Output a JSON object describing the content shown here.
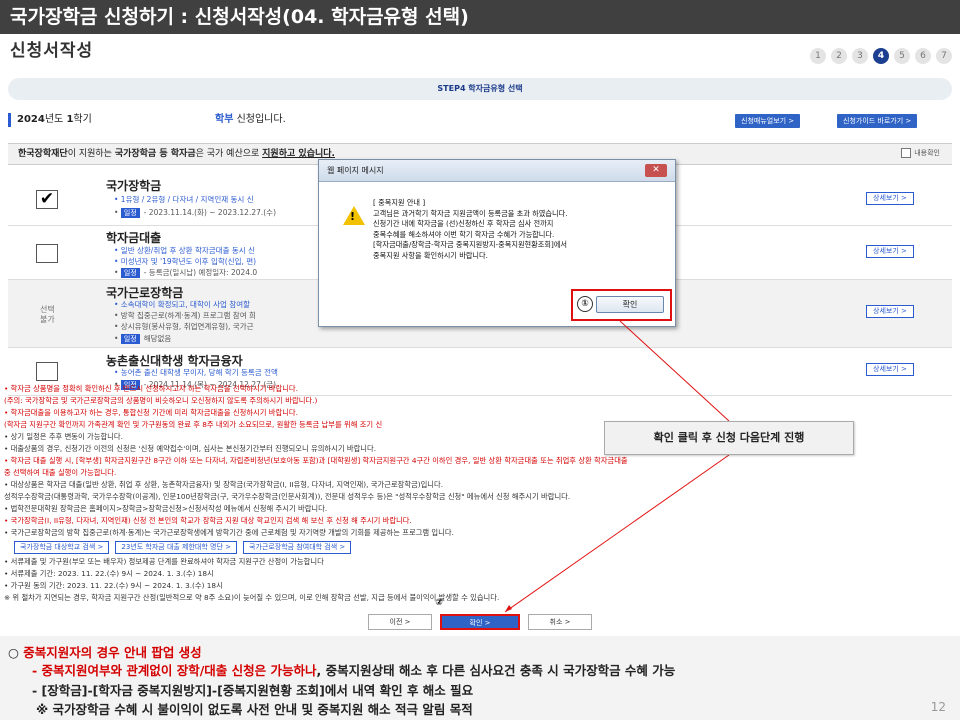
{
  "header": {
    "title": "국가장학금 신청하기 : 신청서작성(04. 학자금유형 선택)",
    "subtitle": "신청서작성",
    "steps": [
      "1",
      "2",
      "3",
      "4",
      "5",
      "6",
      "7"
    ],
    "active_step": "4"
  },
  "step_title": "STEP4 학자금유형 선택",
  "semester": {
    "year": "2024",
    "year_suffix": "년도 ",
    "term": "1",
    "term_suffix": "학기"
  },
  "dept": {
    "name": "학부",
    "text": " 신청입니다."
  },
  "guide_buttons": [
    "신청매뉴얼보기 >",
    "신청가이드 바로가기 >"
  ],
  "notice": {
    "pre": "한국장학재단",
    "mid1": "이 지원하는 ",
    "bold": "국가장학금 등 학자금",
    "mid2": "은 국가 예산으로 ",
    "end": "지원하고 있습니다."
  },
  "confirm_check_label": "내용확인",
  "items": [
    {
      "title": "국가장학금",
      "line1": "• 1유형 / 2유형 / 다자녀 / 지역인재 동시 신",
      "tag": "일정",
      "dates": "- 2023.11.14.(화) ~ 2023.12.27.(수)",
      "checked": true
    },
    {
      "title": "학자금대출",
      "line1": "• 일반 상환/취업 후 상환 학자금대출 동시 신",
      "line2": "• 미성년자 및 '19학년도 이후 입학(신입, 편)",
      "tag": "일정",
      "dates": "- 등록금(일시납) 예정일자: 2024.0",
      "checked": false
    },
    {
      "title": "국가근로장학금",
      "unavailable": "선택\n불가",
      "line1": "• 소속대학이 확정되고, 대학이 사업 참여할",
      "line2": "• 방학 집중근로(하계·동계) 프로그램 참여 희",
      "line3": "• 상시유형(봉사유형, 취업연계유형), 국가근",
      "tag": "일정",
      "dates": "해당없음"
    },
    {
      "title": "농촌출신대학생 학자금융자",
      "line1": "• 농어촌 출신 대학생 무이자, 당해 학기 등록금 전액",
      "tag": "일정",
      "dates": "- 2024.11.14.(목) ~ 2024.12.27.(금)",
      "checked": false
    }
  ],
  "detail_label": "상세보기 >",
  "notes": [
    {
      "c": "red",
      "t": "• 학자금 상품명을 정확히 확인하신 후 반드시 신청하시고자 하는 학자금을 선택하시기 바랍니다."
    },
    {
      "c": "red",
      "t": "  (주의: 국가장학금 및 국가근로장학금의 상품명이 비슷하오니 오신청하지 않도록 주의하시기 바랍니다.)"
    },
    {
      "c": "red",
      "t": "• 학자금대출을 이용하고자 하는 경우, 통합신청 기간에 미리 학자금대출을 신청하시기 바랍니다."
    },
    {
      "c": "red",
      "t": "  (학자금 지원구간 확인까지 가족관계 확인 및 가구원동의 완료 후 8주 내외가 소요되므로, 원활한 등록금 납부를 위해 조기 신"
    },
    {
      "c": "blk",
      "t": "• 상기 일정은 추후 변동이 가능합니다."
    },
    {
      "c": "blk",
      "t": "• 대출상품의 경우, 신청기간 이전의 신청은 '신청 예약접수'이며, 심사는 본신청기간부터 진행되오니 유의하시기 바랍니다."
    },
    {
      "c": "red",
      "t": "• 학자금 대출 실행 시, [학부생] 학자금지원구간 8구간 이하 또는 다자녀, 자립준비청년(보호아동 포함)과 [대학원생] 학자금지원구간 4구간 이하인 경우, 일반 상환 학자금대출 또는 취업후 상환 학자금대출"
    },
    {
      "c": "red",
      "t": "  중 선택하여 대출 실행이 가능합니다."
    },
    {
      "c": "blk",
      "t": "• 대상상품은 학자금 대출(일반 상환, 취업 후 상환, 농촌학자금융자) 및 장학금(국가장학금(I, II유형, 다자녀, 지역인재), 국가근로장학금)입니다."
    },
    {
      "c": "blk",
      "t": "  성적우수장학금(대통령과학, 국가우수장학(이공계), 인문100년장학금(구, 국가우수장학금(인문사회계)), 전문대 성적우수 등)은 \"성적우수장학금 신청\" 메뉴에서 신청 해주시기 바랍니다."
    },
    {
      "c": "blk",
      "t": "• 법학전문대학원 장학금은 홈페이지>장학금>장학금신청>신청서작성 메뉴에서 신청해 주시기 바랍니다."
    },
    {
      "c": "red",
      "t": "• 국가장학금(I, II유형, 다자녀, 지역인재) 신청 전 본인의 학교가 장학금 지원 대상 학교인지 검색 해 보신 후 신청 해 주시기 바랍니다."
    },
    {
      "c": "blk",
      "t": "• 국가근로장학금의 방학 집중근로(하계·동계)는 국가근로장학생에게 방학기간 중에 근로체험 및 자기역량 개발의 기회를 제공하는 프로그램 입니다."
    }
  ],
  "link_buttons": [
    "국가장학금 대상학교 검색 >",
    "23년도 학자금 대출 제한대학 명단 >",
    "국가근로장학금 참여대학 검색 >"
  ],
  "notes2": [
    {
      "c": "blk",
      "t": "• 서류제출 및 가구원(부모 또는 배우자) 정보제공 단계를 완료하셔야 학자금 지원구간 산정이 가능합니다"
    },
    {
      "c": "blk",
      "t": "• 서류제출 기간: 2023. 11. 22.(수) 9시 ~ 2024. 1. 3.(수) 18시"
    },
    {
      "c": "blk",
      "t": "• 가구원 동의 기간: 2023. 11. 22.(수) 9시 ~ 2024. 1. 3.(수) 18시"
    },
    {
      "c": "blk",
      "t": "  ※ 위 절차가 지연되는 경우, 학자금 지원구간 산정(일반적으로 약 8주 소요)이 늦어질 수 있으며, 이로 인해 장학금 선발, 지급 등에서 불이익이 발생할 수 있습니다."
    }
  ],
  "nav": {
    "prev": "이전 >",
    "next": "확인 >",
    "cancel": "취소 >"
  },
  "popup": {
    "title": "웹 페이지 메시지",
    "close": "✕",
    "message": "[ 중복지원 안내 ]\n고객님은 과거학기 학자금 지원금액이 등록금을 초과 하였습니다.\n신청기간 내에 학자금을 (선)신청하신 후 학자금 심사 전까지\n중복수혜를 해소하셔야 이번 학기 학자금 수혜가 가능합니다.\n[학자금대출/장학금-학자금 중복지원방지-중복지원현황조회]에서\n중복지원 사항을 확인하시기 바랍니다.",
    "ok": "확인"
  },
  "markers": {
    "one": "①",
    "two": "②"
  },
  "callout": "확인 클릭 후 신청 다음단계 진행",
  "bottom": {
    "l1_prefix": "○ ",
    "l1": "중복지원자의 경우 안내 팝업 생성",
    "l2a": "- 중복지원여부와 관계없이 장학/대출 신청은 가능하나",
    "l2b": ", 중복지원상태 해소 후 다른 심사요건 충족 시 국가장학금 수혜 가능",
    "l3": "- [장학금]-[학자금 중복지원방지]-[중복지원현황 조회]에서 내역 확인 후 해소 필요",
    "l4": "※ 국가장학금 수혜 시 불이익이 없도록 사전 안내 및 중복지원 해소 적극 알림 목적"
  },
  "page_number": "12",
  "colors": {
    "header_bg": "#404040",
    "accent_blue": "#2a5bd0",
    "highlight_red": "#e01010"
  }
}
